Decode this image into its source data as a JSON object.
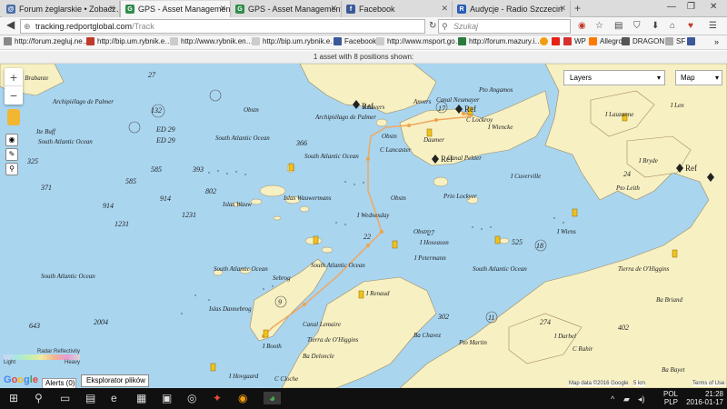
{
  "browser": {
    "tabs": [
      {
        "label": "Forum żeglarskie • Zobacz…",
        "active": false,
        "icon": "forum-icon"
      },
      {
        "label": "GPS - Asset Management …",
        "active": true,
        "icon": "gps-icon"
      },
      {
        "label": "GPS - Asset Management …",
        "active": false,
        "icon": "gps-icon"
      },
      {
        "label": "Facebook",
        "active": false,
        "icon": "facebook-icon"
      },
      {
        "label": "Audycje - Radio Szczecin",
        "active": false,
        "icon": "radio-icon"
      }
    ],
    "url_host": "tracking.redportglobal.com",
    "url_path": "/Track",
    "search_placeholder": "Szukaj",
    "bookmarks": [
      "http://forum.zegluj.ne…",
      "http://bip.um.rybnik.e…",
      "http://www.rybnik.en…",
      "http://bip.um.rybnik.e…",
      "Facebook",
      "http://www.msport.go…",
      "http://forum.mazury.i…",
      "WP",
      "Allegro",
      "DRAGON",
      "SF"
    ]
  },
  "status_bar": "1 asset with 8 positions shown:",
  "map_controls": {
    "zoom_in": "+",
    "zoom_out": "−",
    "layers_label": "Layers",
    "map_type_label": "Map",
    "legend_title": "Radar Reflectivity",
    "legend_light": "Light",
    "legend_heavy": "Heavy",
    "google_logo": "Google",
    "alerts_label": "Alerts (0)",
    "explorer_label": "Eksplorator plików",
    "map_data": "Map data ©2016 Google",
    "scale": "5 km",
    "terms": "Terms of Use"
  },
  "map_labels": {
    "places": [
      "Isla Brabante",
      "Archipiélago de Palmer",
      "I Anvers",
      "Anvers",
      "Canal Neumayer",
      "Pto Angamos",
      "Archipiélago de Palmer",
      "I Wiencke",
      "C Lockroy",
      "C Lancaster",
      "Daumer",
      "Canal Peltier",
      "I Cuverville",
      "I Wednesday",
      "Islas Wauwermans",
      "Islas Wauw",
      "Islas Dannebrog",
      "I Booth",
      "Canal Lemaire",
      "Tierra de O'Higgins",
      "Ba Deloncle",
      "C Cloche",
      "I Hovgaard",
      "Pto Martin",
      "Ba Chavez",
      "I Petermann",
      "I Renaud",
      "I Wiens",
      "I Lauzanne",
      "I Len",
      "I Bryde",
      "Pto Leith",
      "Tierra de O'Higgins",
      "Ba Briand",
      "C Rahir",
      "I Darbel",
      "Ba Bayet",
      "Ite Buff",
      "Sebrog",
      "I Hoseason",
      "Prio Lockyer"
    ],
    "oceans": [
      "South Atlantic Ocean",
      "South Atlantic Ocean",
      "South Atlantic Ocean",
      "South Atlantic Ocean",
      "South Atlantic Ocean",
      "South Atlantic Ocean",
      "South Atlantic Ocean"
    ],
    "depths": [
      "27",
      "132",
      "ED 29",
      "ED 29",
      "325",
      "371",
      "585",
      "914",
      "1231",
      "643",
      "2004",
      "366",
      "585",
      "393",
      "802",
      "914",
      "1231",
      "302",
      "274",
      "525",
      "402",
      "22",
      "18",
      "11",
      "9",
      "27",
      "17",
      "24"
    ],
    "refs": [
      "Ref",
      "Ref",
      "Ref",
      "Ref"
    ],
    "obstr": [
      "Obstn",
      "Obstn",
      "Obstn",
      "Obstn"
    ]
  },
  "taskbar": {
    "language": "POL",
    "keyboard": "PLP",
    "time": "21:28",
    "date": "2016-01-17"
  },
  "colors": {
    "sea": "#a9d5ef",
    "land": "#f7f0c2",
    "track": "#f0a860",
    "marker": "#f2c21b"
  }
}
